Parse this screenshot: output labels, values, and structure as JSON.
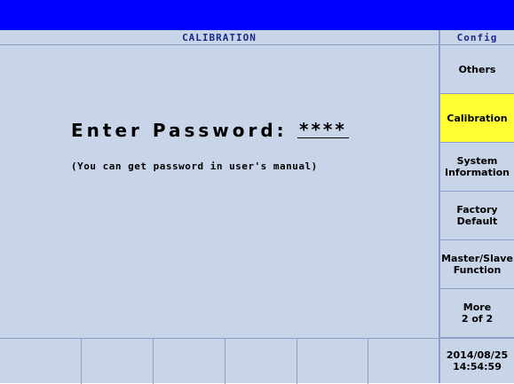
{
  "header": {
    "left_title": "CALIBRATION",
    "right_title": "Config"
  },
  "password": {
    "label": "Enter Password:",
    "value": "****"
  },
  "hint": "(You can get password in user's manual)",
  "softkeys": [
    {
      "label": "Others",
      "active": false
    },
    {
      "label": "Calibration",
      "active": true
    },
    {
      "label": "System\nInformation",
      "active": false
    },
    {
      "label": "Factory\nDefault",
      "active": false
    },
    {
      "label": "Master/Slave\nFunction",
      "active": false
    },
    {
      "label": "More\n2 of 2",
      "active": false
    }
  ],
  "datetime": {
    "date": "2014/08/25",
    "time": "14:54:59"
  },
  "colors": {
    "topbar": "#0000ff",
    "background": "#c8d4e8",
    "active_key": "#ffff33",
    "title_text": "#1a2a88"
  }
}
